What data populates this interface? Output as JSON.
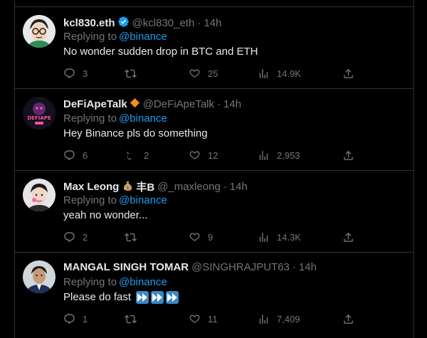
{
  "tweets": [
    {
      "name": "kcl830.eth",
      "handle": "@kcl830_eth",
      "time": "14h",
      "verified": true,
      "reply_prefix": "Replying to",
      "reply_to": "@binance",
      "text": "No wonder sudden drop in BTC and ETH",
      "replies": "3",
      "retweets": "",
      "likes": "25",
      "views": "14.9K"
    },
    {
      "name": "DeFiApeTalk",
      "handle": "@DeFiApeTalk",
      "time": "14h",
      "badge_icon": "orange-diamond-icon",
      "reply_prefix": "Replying to",
      "reply_to": "@binance",
      "text": "Hey Binance pls do something",
      "replies": "6",
      "retweets": "2",
      "likes": "12",
      "views": "2,953",
      "avatar_text": "DEFIAPE"
    },
    {
      "name": "Max Leong",
      "name_suffix": "丰B",
      "handle": "@_maxleong",
      "time": "14h",
      "badge_icon": "money-bag-icon",
      "reply_prefix": "Replying to",
      "reply_to": "@binance",
      "text": "yeah no wonder...",
      "replies": "2",
      "retweets": "",
      "likes": "9",
      "views": "14.3K"
    },
    {
      "name": "MANGAL SINGH TOMAR",
      "handle": "@SINGHRAJPUT63",
      "time": "14h",
      "reply_prefix": "Replying to",
      "reply_to": "@binance",
      "text": "Please do fast",
      "text_emoji": "fast-forward-icon x3",
      "replies": "1",
      "retweets": "",
      "likes": "11",
      "views": "7,409"
    }
  ],
  "colors": {
    "background": "#000000",
    "text": "#e7e9ea",
    "muted": "#71767b",
    "link": "#1d9bf0",
    "border": "#2f3336",
    "verified": "#1d9bf0"
  }
}
